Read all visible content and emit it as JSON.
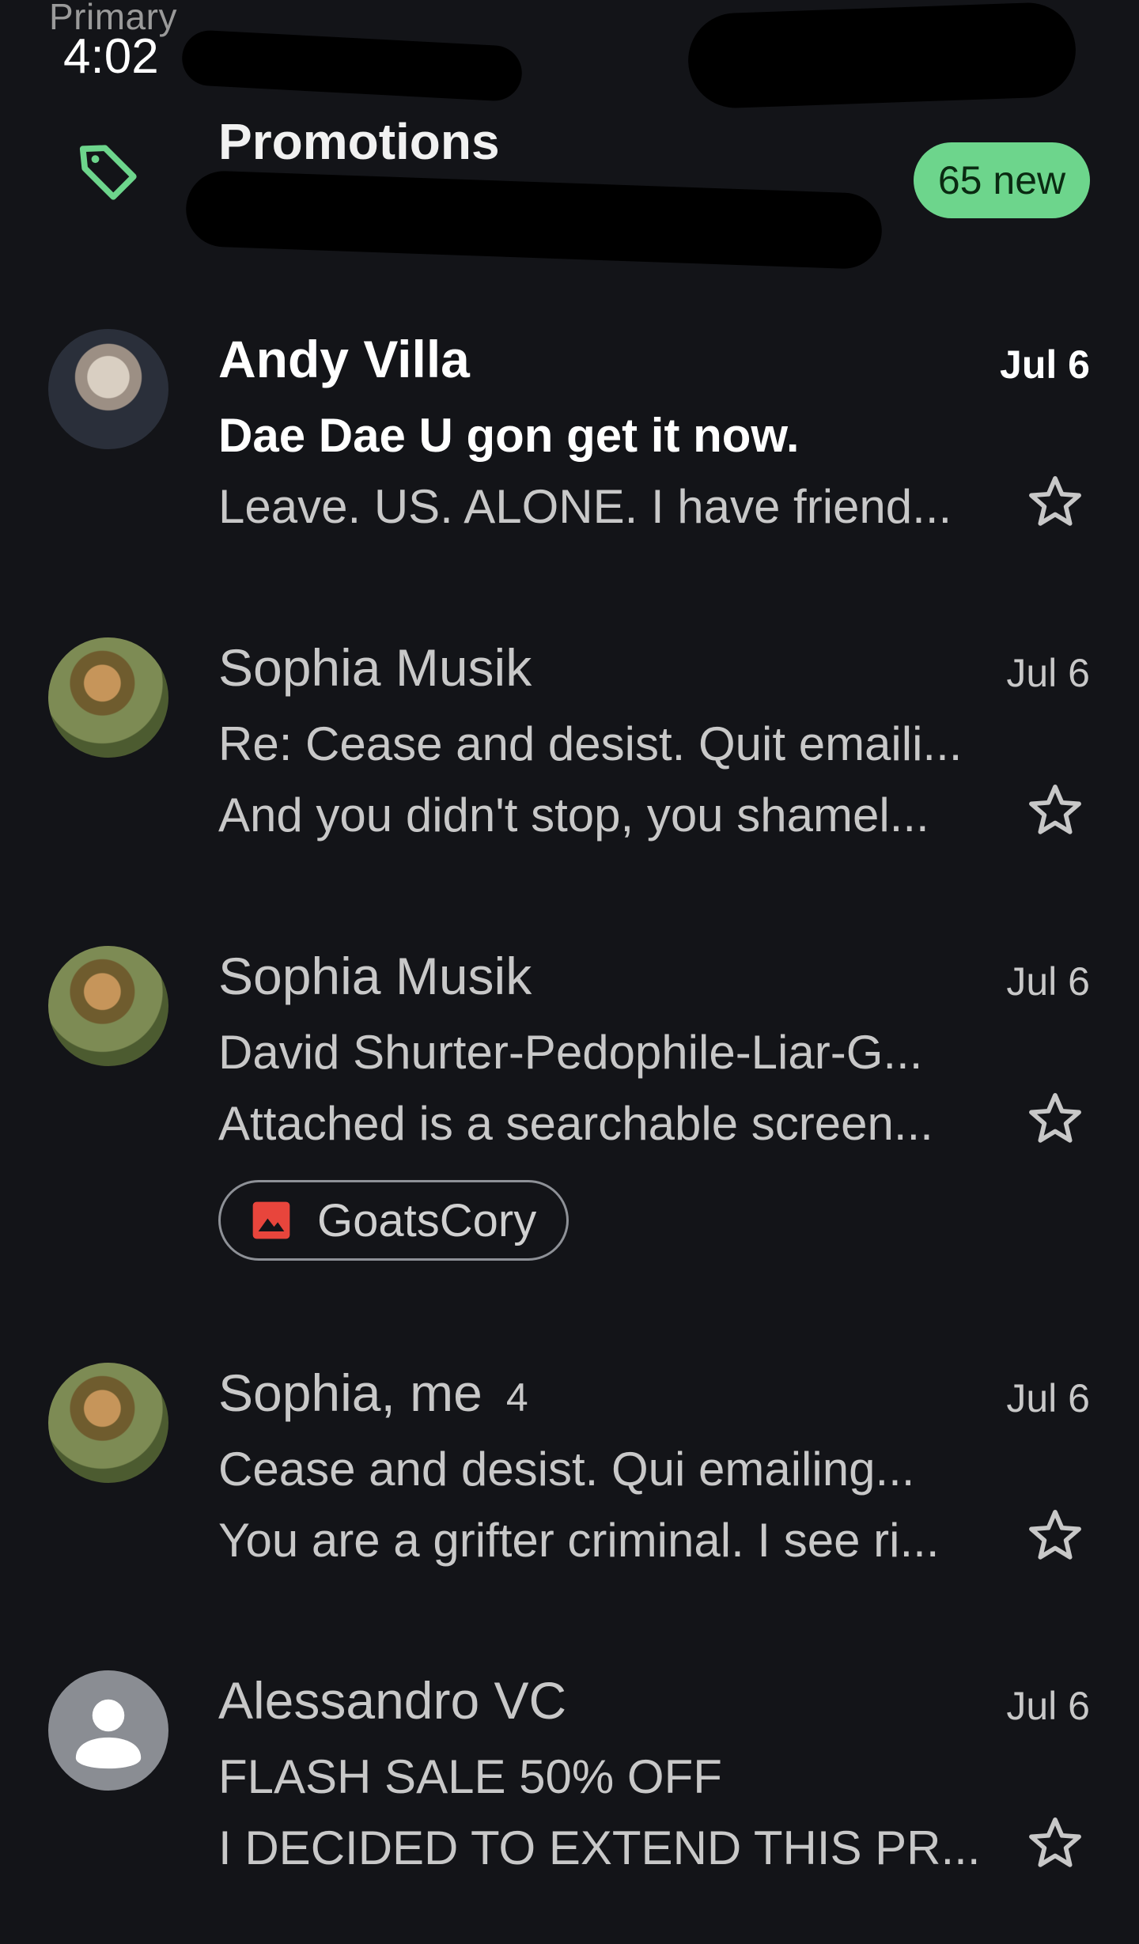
{
  "status_bar": {
    "section_label": "Primary",
    "time": "4:02"
  },
  "category": {
    "icon": "tag-icon",
    "title": "Promotions",
    "badge": "65 new",
    "accent_color": "#6dd58c"
  },
  "emails": [
    {
      "sender": "Andy Villa",
      "count": "",
      "date": "Jul 6",
      "subject": "Dae Dae U gon get it now.",
      "snippet": "Leave. US. ALONE. I have friend...",
      "unread": true
    },
    {
      "sender": "Sophia Musik",
      "count": "",
      "date": "Jul 6",
      "subject": "Re: Cease and desist. Quit emaili...",
      "snippet": "And you didn't stop, you shamel...",
      "unread": false
    },
    {
      "sender": "Sophia Musik",
      "count": "",
      "date": "Jul 6",
      "subject": "David Shurter-Pedophile-Liar-G...",
      "snippet": "Attached is a searchable screen...",
      "attachment": "GoatsCory",
      "unread": false
    },
    {
      "sender": "Sophia, me",
      "count": "4",
      "date": "Jul 6",
      "subject": "Cease and desist. Qui emailing...",
      "snippet": "You are a grifter criminal. I see ri...",
      "unread": false
    },
    {
      "sender": "Alessandro VC",
      "count": "",
      "date": "Jul 6",
      "subject": "FLASH SALE 50% OFF",
      "snippet": "I DECIDED TO EXTEND THIS PR...",
      "unread": false
    }
  ]
}
